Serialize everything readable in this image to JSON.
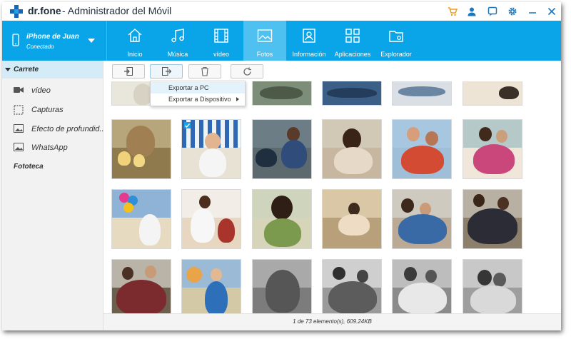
{
  "app": {
    "brand": "dr.fone",
    "title": "- Administrador del Móvil"
  },
  "titlebar_icons": [
    "cart-icon",
    "user-icon",
    "feedback-icon",
    "settings-icon",
    "minimize-icon",
    "close-icon"
  ],
  "device": {
    "name": "iPhone de Juan",
    "status": "Conectado"
  },
  "nav": [
    {
      "label": "Inicio",
      "icon": "home-icon"
    },
    {
      "label": "Música",
      "icon": "music-icon"
    },
    {
      "label": "vídeo",
      "icon": "video-icon"
    },
    {
      "label": "Fotos",
      "icon": "photo-icon",
      "active": true
    },
    {
      "label": "Información",
      "icon": "contact-icon"
    },
    {
      "label": "Aplicaciones",
      "icon": "apps-icon"
    },
    {
      "label": "Explorador",
      "icon": "folder-icon"
    }
  ],
  "sidebar": {
    "section": "Carrete",
    "items": [
      {
        "label": "vídeo",
        "icon": "video-camera-icon"
      },
      {
        "label": "Capturas",
        "icon": "screenshot-icon"
      },
      {
        "label": "Efecto de profundid...",
        "icon": "image-icon"
      },
      {
        "label": "WhatsApp",
        "icon": "image-icon"
      }
    ],
    "library": "Fototeca"
  },
  "toolbar": {
    "buttons": [
      "import-icon",
      "export-icon",
      "delete-icon",
      "refresh-icon"
    ]
  },
  "export_menu": {
    "items": [
      {
        "label": "Exportar a PC"
      },
      {
        "label": "Exportar a Dispositivo"
      }
    ]
  },
  "status": {
    "text": "1 de 73 elemento(s), 609.24KB"
  },
  "colors": {
    "accent": "#0aa5e8",
    "nav_active": "#4fc1f0",
    "sidebar_bg": "#f2f2f2",
    "sidebar_selected": "#d4ecf7"
  }
}
